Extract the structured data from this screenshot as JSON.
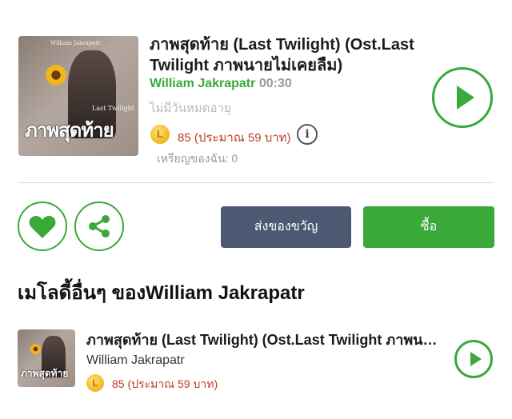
{
  "product": {
    "title": "ภาพสุดท้าย (Last Twilight) (Ost.Last Twilight ภาพนายไม่เคยลืม)",
    "artist": "William Jakrapatr",
    "duration": "00:30",
    "validity": "ไม่มีวันหมดอายุ",
    "coin_symbol": "L",
    "price": "85 (ประมาณ 59 บาท)",
    "info_symbol": "i",
    "my_coins": "เหรียญของฉัน: 0",
    "cover_artist": "William Jakrapatr",
    "cover_subtitle": "Last Twilight",
    "cover_big_text": "ภาพสุดท้าย"
  },
  "actions": {
    "gift_label": "ส่งของขวัญ",
    "buy_label": "ซื้อ",
    "favorite_icon": "heart-icon",
    "share_icon": "share-icon",
    "play_icon": "play-icon"
  },
  "other_section": {
    "title": "เมโลดี้อื่นๆ ของWilliam Jakrapatr",
    "items": [
      {
        "title": "ภาพสุดท้าย (Last Twilight) (Ost.Last Twilight ภาพนายไม่เคยลืม)",
        "artist": "William Jakrapatr",
        "coin_symbol": "L",
        "price": "85 (ประมาณ 59 บาท)",
        "cover_big_text": "ภาพสุดท้าย"
      }
    ]
  },
  "colors": {
    "accent_green": "#3aa93a",
    "gift_button": "#4d5973",
    "price_red": "#c0392b"
  }
}
